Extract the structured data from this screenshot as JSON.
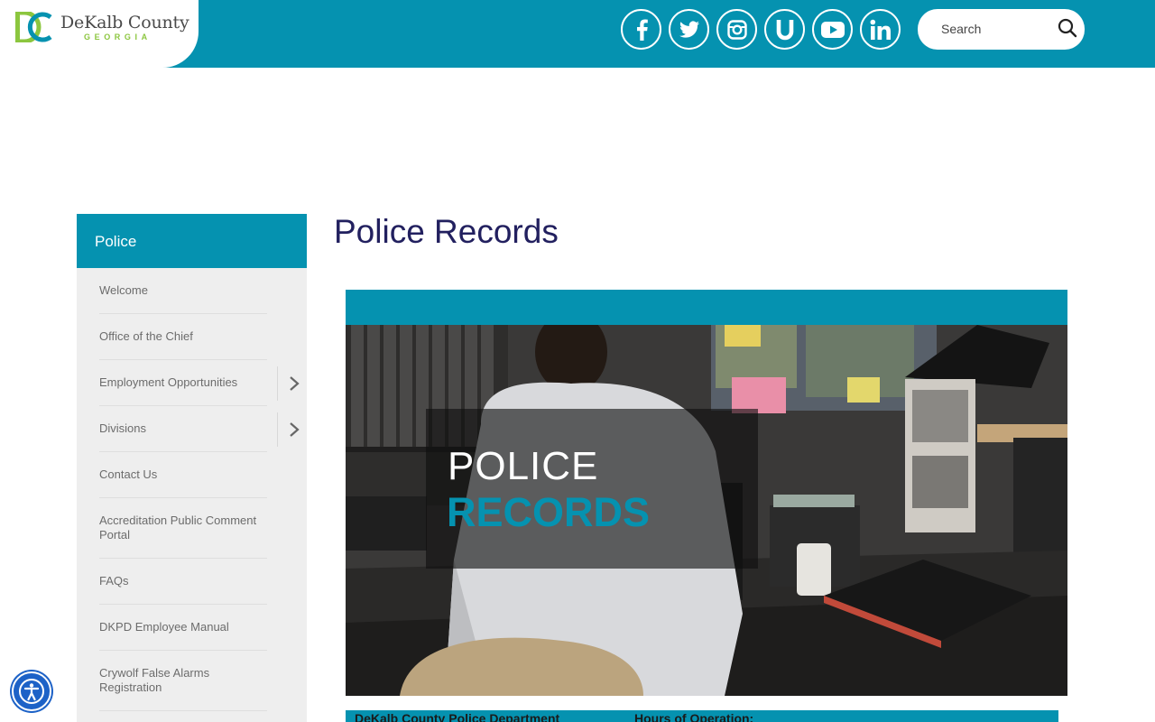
{
  "brand": {
    "name": "DeKalb County",
    "state": "GEORGIA",
    "colors": {
      "primary": "#0592b0",
      "green": "#8cc63f",
      "navy": "#22205f"
    }
  },
  "social": [
    {
      "name": "facebook",
      "icon": "facebook-icon"
    },
    {
      "name": "twitter",
      "icon": "twitter-icon"
    },
    {
      "name": "instagram",
      "icon": "instagram-icon"
    },
    {
      "name": "u",
      "icon": "u-icon"
    },
    {
      "name": "youtube",
      "icon": "youtube-icon"
    },
    {
      "name": "linkedin",
      "icon": "linkedin-icon"
    }
  ],
  "search": {
    "placeholder": "Search",
    "icon": "search-icon"
  },
  "sidebar": {
    "heading": "Police",
    "items": [
      {
        "label": "Welcome"
      },
      {
        "label": "Office of the Chief"
      },
      {
        "label": "Employment Opportunities",
        "expandable": true
      },
      {
        "label": "Divisions",
        "expandable": true
      },
      {
        "label": "Contact Us"
      },
      {
        "label": "Accreditation Public Comment Portal"
      },
      {
        "label": "FAQs"
      },
      {
        "label": "DKPD Employee Manual"
      },
      {
        "label": "Crywolf False Alarms Registration"
      }
    ]
  },
  "main": {
    "title": "Police Records",
    "hero": {
      "line1": "POLICE",
      "line2": "RECORDS"
    },
    "info_bar": {
      "left": "DeKalb County Police Department",
      "right": "Hours of Operation:"
    }
  },
  "accessibility": {
    "icon": "accessibility-icon"
  }
}
